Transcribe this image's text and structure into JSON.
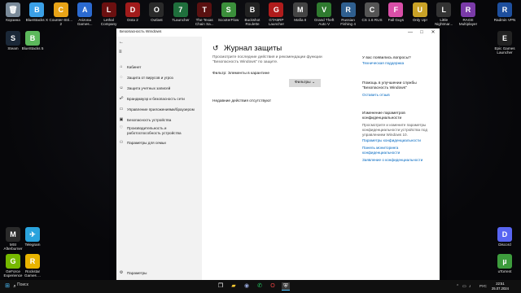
{
  "desktop": {
    "icons_top": [
      {
        "label": "Корзина",
        "color": "#7a8a99",
        "glyph": "🗑"
      },
      {
        "label": "BlueStacks X",
        "color": "#3ba0e6",
        "glyph": "B"
      },
      {
        "label": "Counter-Stri... 2",
        "color": "#e8a317",
        "glyph": "C"
      },
      {
        "label": "Arizona Games...",
        "color": "#2b6ad0",
        "glyph": "A"
      },
      {
        "label": "Lethal Company",
        "color": "#6b1010",
        "glyph": "L"
      },
      {
        "label": "Dota 2",
        "color": "#a11b1b",
        "glyph": "D"
      },
      {
        "label": "Outlast",
        "color": "#2a2a2a",
        "glyph": "O"
      },
      {
        "label": "7Launcher",
        "color": "#1f6f3c",
        "glyph": "7"
      },
      {
        "label": "The Texas Chain Sa...",
        "color": "#5a1111",
        "glyph": "T"
      },
      {
        "label": "ScooterFlow",
        "color": "#3b8f3b",
        "glyph": "S"
      },
      {
        "label": "Buckshot Roulette",
        "color": "#222",
        "glyph": "B"
      },
      {
        "label": "GTA5RP Launcher",
        "color": "#b01c1c",
        "glyph": "G"
      },
      {
        "label": "Mafia II",
        "color": "#444",
        "glyph": "M"
      },
      {
        "label": "Grand Theft Auto V",
        "color": "#2f7a2f",
        "glyph": "V"
      },
      {
        "label": "Russian Fishing 4",
        "color": "#2f5f8f",
        "glyph": "R"
      },
      {
        "label": "CS 1.6 RUS",
        "color": "#555",
        "glyph": "C"
      },
      {
        "label": "Fall Guys",
        "color": "#d94fa8",
        "glyph": "F"
      },
      {
        "label": "Only Up!",
        "color": "#c9a227",
        "glyph": "U"
      },
      {
        "label": "Little Nightmar...",
        "color": "#333",
        "glyph": "L"
      },
      {
        "label": "RAGE Multiplayer",
        "color": "#7a3aa8",
        "glyph": "R"
      }
    ],
    "icons_left": [
      {
        "label": "Steam",
        "color": "#1b2838",
        "glyph": "S"
      },
      {
        "label": "BlueStacks 5",
        "color": "#5cb85c",
        "glyph": "B"
      },
      {
        "label": "MSI Afterburner",
        "color": "#2a2a2a",
        "glyph": "M"
      },
      {
        "label": "Telegram",
        "color": "#2aa3dd",
        "glyph": "✈"
      },
      {
        "label": "GeForce Experience",
        "color": "#76b900",
        "glyph": "G"
      },
      {
        "label": "Rockstar Games ...",
        "color": "#e8b400",
        "glyph": "R"
      }
    ],
    "icons_right": [
      {
        "label": "Radmin VPN",
        "color": "#1e4f9e",
        "glyph": "R"
      },
      {
        "label": "Epic Games Launcher",
        "color": "#222",
        "glyph": "E"
      },
      {
        "label": "Discord",
        "color": "#5865f2",
        "glyph": "D"
      },
      {
        "label": "uTorrent",
        "color": "#3d9c3d",
        "glyph": "µ"
      }
    ]
  },
  "window": {
    "title": "Безопасность Windows",
    "controls": {
      "minimize": "—",
      "maximize": "□",
      "close": "✕"
    }
  },
  "sidebar": {
    "back": "←",
    "menu": "≡",
    "items": [
      {
        "label": "Кабинет",
        "icon": "⌂"
      },
      {
        "label": "Защита от вирусов и угроз",
        "icon": "◌"
      },
      {
        "label": "Защита учетных записей",
        "icon": "☺"
      },
      {
        "label": "Брандмауэр и безопасность сети",
        "icon": "☍"
      },
      {
        "label": "Управление приложениями/браузером",
        "icon": "▭"
      },
      {
        "label": "Безопасность устройства",
        "icon": "▣"
      },
      {
        "label": "Производительность и работоспособность устройства",
        "icon": "♡"
      },
      {
        "label": "Параметры для семьи",
        "icon": "⚇"
      }
    ],
    "settings": {
      "label": "Параметры",
      "icon": "⚙"
    }
  },
  "main": {
    "title": "Журнал защиты",
    "title_icon": "↺",
    "description": "Просмотрите последние действия и рекомендации функции \"Безопасность Windows\" по защите.",
    "filter_label": "Фильтр: Элементы в карантине",
    "filter_button": "Фильтры",
    "filter_chevron": "⌄",
    "empty_message": "Недавние действия отсутствуют"
  },
  "right": {
    "questions_title": "У вас появились вопросы?",
    "questions_link": "Техническая поддержка",
    "improve_title": "Помощь в улучшении службы \"Безопасность Windows\"",
    "improve_link": "Оставить отзыв",
    "privacy_title": "Изменение параметров конфиденциальности",
    "privacy_text": "Просмотрите и измените параметры конфиденциальности устройства под управлением Windows 10.",
    "privacy_links": [
      "Параметры конфиденциальности",
      "Панель мониторинга конфиденциальности",
      "Заявление о конфиденциальности"
    ]
  },
  "taskbar": {
    "search_label": "Поиск",
    "lang": "РУС",
    "time": "22:51",
    "date": "25.07.2024"
  }
}
